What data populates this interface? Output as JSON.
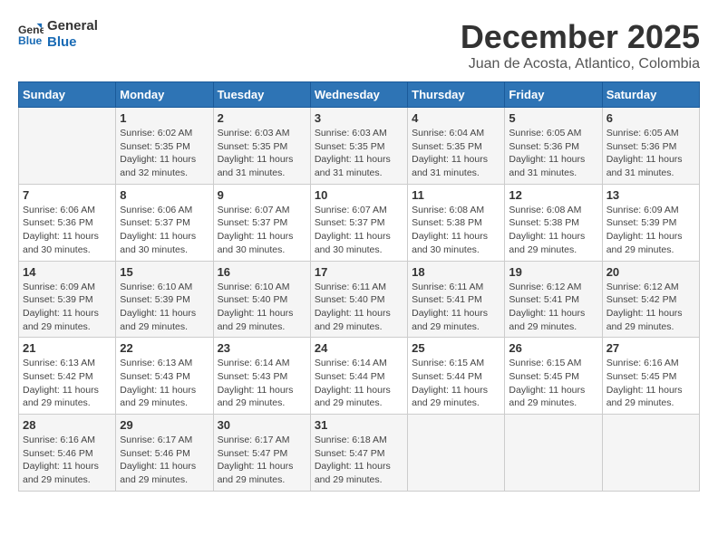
{
  "logo": {
    "line1": "General",
    "line2": "Blue"
  },
  "title": "December 2025",
  "subtitle": "Juan de Acosta, Atlantico, Colombia",
  "days_header": [
    "Sunday",
    "Monday",
    "Tuesday",
    "Wednesday",
    "Thursday",
    "Friday",
    "Saturday"
  ],
  "weeks": [
    [
      {
        "day": "",
        "info": ""
      },
      {
        "day": "1",
        "info": "Sunrise: 6:02 AM\nSunset: 5:35 PM\nDaylight: 11 hours and 32 minutes."
      },
      {
        "day": "2",
        "info": "Sunrise: 6:03 AM\nSunset: 5:35 PM\nDaylight: 11 hours and 31 minutes."
      },
      {
        "day": "3",
        "info": "Sunrise: 6:03 AM\nSunset: 5:35 PM\nDaylight: 11 hours and 31 minutes."
      },
      {
        "day": "4",
        "info": "Sunrise: 6:04 AM\nSunset: 5:35 PM\nDaylight: 11 hours and 31 minutes."
      },
      {
        "day": "5",
        "info": "Sunrise: 6:05 AM\nSunset: 5:36 PM\nDaylight: 11 hours and 31 minutes."
      },
      {
        "day": "6",
        "info": "Sunrise: 6:05 AM\nSunset: 5:36 PM\nDaylight: 11 hours and 31 minutes."
      }
    ],
    [
      {
        "day": "7",
        "info": "Sunrise: 6:06 AM\nSunset: 5:36 PM\nDaylight: 11 hours and 30 minutes."
      },
      {
        "day": "8",
        "info": "Sunrise: 6:06 AM\nSunset: 5:37 PM\nDaylight: 11 hours and 30 minutes."
      },
      {
        "day": "9",
        "info": "Sunrise: 6:07 AM\nSunset: 5:37 PM\nDaylight: 11 hours and 30 minutes."
      },
      {
        "day": "10",
        "info": "Sunrise: 6:07 AM\nSunset: 5:37 PM\nDaylight: 11 hours and 30 minutes."
      },
      {
        "day": "11",
        "info": "Sunrise: 6:08 AM\nSunset: 5:38 PM\nDaylight: 11 hours and 30 minutes."
      },
      {
        "day": "12",
        "info": "Sunrise: 6:08 AM\nSunset: 5:38 PM\nDaylight: 11 hours and 29 minutes."
      },
      {
        "day": "13",
        "info": "Sunrise: 6:09 AM\nSunset: 5:39 PM\nDaylight: 11 hours and 29 minutes."
      }
    ],
    [
      {
        "day": "14",
        "info": "Sunrise: 6:09 AM\nSunset: 5:39 PM\nDaylight: 11 hours and 29 minutes."
      },
      {
        "day": "15",
        "info": "Sunrise: 6:10 AM\nSunset: 5:39 PM\nDaylight: 11 hours and 29 minutes."
      },
      {
        "day": "16",
        "info": "Sunrise: 6:10 AM\nSunset: 5:40 PM\nDaylight: 11 hours and 29 minutes."
      },
      {
        "day": "17",
        "info": "Sunrise: 6:11 AM\nSunset: 5:40 PM\nDaylight: 11 hours and 29 minutes."
      },
      {
        "day": "18",
        "info": "Sunrise: 6:11 AM\nSunset: 5:41 PM\nDaylight: 11 hours and 29 minutes."
      },
      {
        "day": "19",
        "info": "Sunrise: 6:12 AM\nSunset: 5:41 PM\nDaylight: 11 hours and 29 minutes."
      },
      {
        "day": "20",
        "info": "Sunrise: 6:12 AM\nSunset: 5:42 PM\nDaylight: 11 hours and 29 minutes."
      }
    ],
    [
      {
        "day": "21",
        "info": "Sunrise: 6:13 AM\nSunset: 5:42 PM\nDaylight: 11 hours and 29 minutes."
      },
      {
        "day": "22",
        "info": "Sunrise: 6:13 AM\nSunset: 5:43 PM\nDaylight: 11 hours and 29 minutes."
      },
      {
        "day": "23",
        "info": "Sunrise: 6:14 AM\nSunset: 5:43 PM\nDaylight: 11 hours and 29 minutes."
      },
      {
        "day": "24",
        "info": "Sunrise: 6:14 AM\nSunset: 5:44 PM\nDaylight: 11 hours and 29 minutes."
      },
      {
        "day": "25",
        "info": "Sunrise: 6:15 AM\nSunset: 5:44 PM\nDaylight: 11 hours and 29 minutes."
      },
      {
        "day": "26",
        "info": "Sunrise: 6:15 AM\nSunset: 5:45 PM\nDaylight: 11 hours and 29 minutes."
      },
      {
        "day": "27",
        "info": "Sunrise: 6:16 AM\nSunset: 5:45 PM\nDaylight: 11 hours and 29 minutes."
      }
    ],
    [
      {
        "day": "28",
        "info": "Sunrise: 6:16 AM\nSunset: 5:46 PM\nDaylight: 11 hours and 29 minutes."
      },
      {
        "day": "29",
        "info": "Sunrise: 6:17 AM\nSunset: 5:46 PM\nDaylight: 11 hours and 29 minutes."
      },
      {
        "day": "30",
        "info": "Sunrise: 6:17 AM\nSunset: 5:47 PM\nDaylight: 11 hours and 29 minutes."
      },
      {
        "day": "31",
        "info": "Sunrise: 6:18 AM\nSunset: 5:47 PM\nDaylight: 11 hours and 29 minutes."
      },
      {
        "day": "",
        "info": ""
      },
      {
        "day": "",
        "info": ""
      },
      {
        "day": "",
        "info": ""
      }
    ]
  ]
}
